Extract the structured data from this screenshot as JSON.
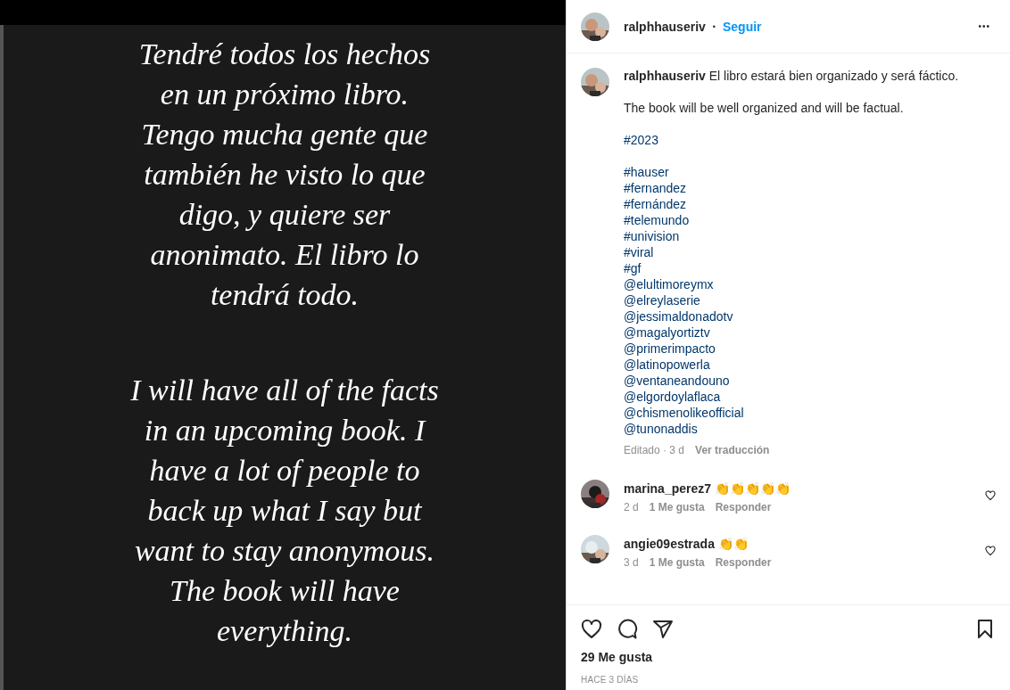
{
  "story": {
    "paragraphs": [
      {
        "lines": [
          "Tendré todos los hechos",
          "en un próximo libro.",
          "Tengo mucha gente que",
          "también he visto lo que",
          "digo, y quiere ser",
          "anonimato. El libro lo",
          "tendrá todo."
        ]
      },
      {
        "lines": [
          "I will have all of the facts",
          "in an upcoming book. I",
          "have a lot of people to",
          "back up what I say but",
          "want to stay anonymous.",
          "The book will have",
          "everything."
        ]
      }
    ]
  },
  "header": {
    "username": "ralphhauseriv",
    "separator": "•",
    "follow": "Seguir",
    "more": "•••"
  },
  "caption": {
    "username": "ralphhauseriv",
    "text": "El libro estará bien organizado y será fáctico.",
    "translation": "The book will be well organized and will be factual.",
    "year_tag": "#2023",
    "tags": [
      "#hauser",
      "#fernandez",
      "#fernández",
      "#telemundo",
      "#univision",
      "#viral",
      "#gf",
      "@elultimoreymx",
      "@elreylaserie",
      "@jessimaldonadotv",
      "@magalyortiztv",
      "@primerimpacto",
      "@latinopowerla",
      "@ventaneandouno",
      "@elgordoylaflaca",
      "@chismenolikeofficial",
      "@tunonaddis"
    ],
    "edited": "Editado · 3 d",
    "translate": "Ver traducción"
  },
  "comments": [
    {
      "username": "marina_perez7",
      "text": "👏👏👏👏👏",
      "age": "2 d",
      "likes": "1 Me gusta",
      "reply": "Responder",
      "liked": false
    },
    {
      "username": "angie09estrada",
      "text": "👏👏",
      "age": "3 d",
      "likes": "1 Me gusta",
      "reply": "Responder",
      "liked": false
    }
  ],
  "footer": {
    "likes": "29 Me gusta",
    "date": "HACE 3 DÍAS"
  }
}
